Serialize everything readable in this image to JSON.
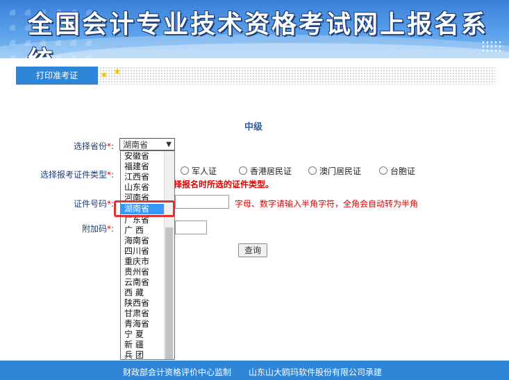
{
  "banner": {
    "title": "全国会计专业技术资格考试网上报名系统"
  },
  "tabs": {
    "print_label": "打印准考证"
  },
  "main": {
    "level": "中级",
    "province_label": "选择省份",
    "required_mark": "*",
    "province_selected": "湖南省",
    "doc_type_label": "选择报考证件类型",
    "doc_types": [
      "军人证",
      "香港居民证",
      "澳门居民证",
      "台胞证"
    ],
    "doc_type_hint": "择报名时所选的证件类型。",
    "id_label": "证件号码",
    "id_hint": "字母、数字请输入半角字符，全角会自动转为半角",
    "extra_label": "附加码",
    "query_button": "查询"
  },
  "dropdown": {
    "options": [
      "安徽省",
      "福建省",
      "江西省",
      "山东省",
      "河南省",
      "湖南省",
      "广东省",
      "广 西",
      "海南省",
      "四川省",
      "重庆市",
      "贵州省",
      "云南省",
      "西 藏",
      "陕西省",
      "甘肃省",
      "青海省",
      "宁 夏",
      "新 疆",
      "兵 团"
    ],
    "selected_index": 5
  },
  "footer": {
    "supervisor": "财政部会计资格评价中心监制",
    "developer": "山东山大鸥玛软件股份有限公司承建"
  },
  "colors": {
    "accent": "#2f86d8",
    "required": "#dd0000",
    "label": "#1e3f7a",
    "highlight": "#e03030"
  }
}
